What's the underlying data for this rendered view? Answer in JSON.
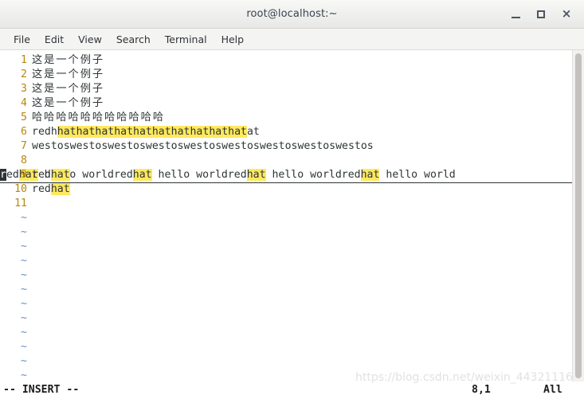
{
  "window": {
    "title": "root@localhost:~",
    "controls": {
      "minimize": "minimize",
      "maximize": "maximize",
      "close": "×"
    }
  },
  "menubar": {
    "items": [
      {
        "label": "File"
      },
      {
        "label": "Edit"
      },
      {
        "label": "View"
      },
      {
        "label": "Search"
      },
      {
        "label": "Terminal"
      },
      {
        "label": "Help"
      }
    ]
  },
  "editor": {
    "lines": [
      {
        "number": "1",
        "text": "这是一个例子",
        "cjk": true
      },
      {
        "number": "2",
        "text": "这是一个例子",
        "cjk": true
      },
      {
        "number": "3",
        "text": "这是一个例子",
        "cjk": true
      },
      {
        "number": "4",
        "text": "这是一个例子",
        "cjk": true
      },
      {
        "number": "5",
        "text": "哈哈哈哈哈哈哈哈哈哈哈",
        "cjk": true
      },
      {
        "number": "6",
        "cjk": false,
        "segments": [
          {
            "text": "redh",
            "style": "plain"
          },
          {
            "text": "hathathathathathathathathathat",
            "style": "highlight"
          },
          {
            "text": "at",
            "style": "plain"
          }
        ]
      },
      {
        "number": "7",
        "cjk": false,
        "segments": [
          {
            "text": "westoswestoswestoswestoswestoswestoswestoswestoswestos",
            "style": "plain"
          }
        ]
      },
      {
        "number": "8",
        "cjk": false,
        "cursorline": true,
        "segments": [
          {
            "text": "r",
            "style": "cursor"
          },
          {
            "text": "ed",
            "style": "plain"
          },
          {
            "text": "hat",
            "style": "highlight"
          },
          {
            "text": " hello worldred",
            "style": "plain"
          },
          {
            "text": "hat",
            "style": "highlight"
          },
          {
            "text": " hello worldred",
            "style": "plain"
          },
          {
            "text": "hat",
            "style": "highlight"
          },
          {
            "text": " hello worldred",
            "style": "plain"
          },
          {
            "text": "hat",
            "style": "highlight"
          },
          {
            "text": " hello world",
            "style": "plain"
          }
        ]
      },
      {
        "number": "9",
        "cjk": false,
        "segments": [
          {
            "text": "red",
            "style": "plain"
          },
          {
            "text": "hat",
            "style": "highlight"
          }
        ]
      },
      {
        "number": "10",
        "cjk": false,
        "segments": [
          {
            "text": "red",
            "style": "plain"
          },
          {
            "text": "hat",
            "style": "highlight"
          }
        ]
      },
      {
        "number": "11",
        "cjk": false,
        "segments": []
      }
    ],
    "filler_marker": "~",
    "filler_count": 12
  },
  "statusline": {
    "mode": "-- INSERT --",
    "position": "8,1",
    "scroll_state": "All"
  },
  "watermark": {
    "text": "https://blog.csdn.net/weixin_44321116"
  },
  "colors": {
    "highlight": "#ffe95e",
    "linenumber": "#b8860b",
    "tilde": "#6c8ebf",
    "text": "#2e3436",
    "titlebar_text": "#3b4450"
  }
}
